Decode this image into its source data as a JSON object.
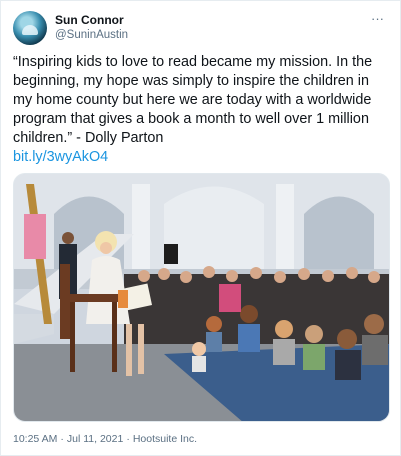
{
  "author": {
    "name": "Sun Connor",
    "handle": "@SuninAustin"
  },
  "menu": {
    "more_label": "···"
  },
  "tweet": {
    "text": "“Inspiring kids to love to read became my mission. In the beginning, my hope was simply to inspire the children in my home county but here we are today with a worldwide program that gives a book a month to well over 1 million children.” - Dolly Parton",
    "link": "bit.ly/3wyAkO4",
    "time": "10:25 AM",
    "date": "Jul 11, 2021",
    "source": "Hootsuite Inc."
  },
  "colors": {
    "link": "#1b95e0",
    "secondary_text": "#5b7083",
    "border": "#e6ecf0"
  },
  "icons": {
    "avatar": "avatar-image",
    "more": "more-options-icon"
  }
}
